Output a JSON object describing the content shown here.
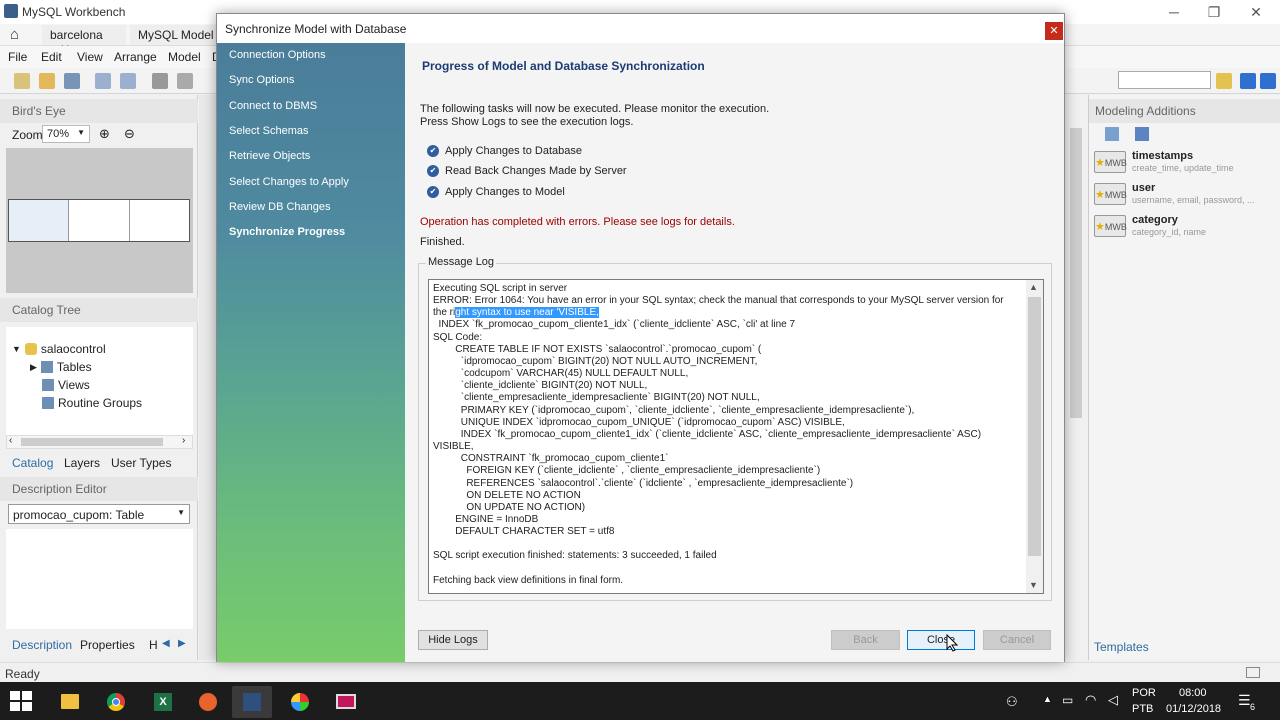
{
  "app": {
    "title": "MySQL Workbench",
    "tabs": [
      "barcelona",
      "MySQL Model (mo"
    ],
    "menu": [
      "File",
      "Edit",
      "View",
      "Arrange",
      "Model",
      "D"
    ],
    "status": "Ready"
  },
  "left": {
    "birds_eye": "Bird's Eye",
    "zoom_label": "Zoom:",
    "zoom_value": "70%",
    "catalog_tree": "Catalog Tree",
    "schema": "salaocontrol",
    "tree_items": [
      "Tables",
      "Views",
      "Routine Groups"
    ],
    "subtabs": [
      "Catalog",
      "Layers",
      "User Types"
    ],
    "description_editor": "Description Editor",
    "desc_select": "promocao_cupom: Table",
    "bottom_tabs": [
      "Description",
      "Properties",
      "H"
    ]
  },
  "right": {
    "header": "Modeling Additions",
    "items": [
      {
        "title": "timestamps",
        "sub": "create_time, update_time"
      },
      {
        "title": "user",
        "sub": "username, email, password, ..."
      },
      {
        "title": "category",
        "sub": "category_id, name"
      }
    ],
    "templates": "Templates"
  },
  "dialog": {
    "title": "Synchronize Model with Database",
    "steps": [
      "Connection Options",
      "Sync Options",
      "Connect to DBMS",
      "Select Schemas",
      "Retrieve Objects",
      "Select Changes to Apply",
      "Review DB Changes",
      "Synchronize Progress"
    ],
    "heading": "Progress of Model and Database Synchronization",
    "intro1": "The following tasks will now be executed. Please monitor the execution.",
    "intro2": "Press Show Logs to see the execution logs.",
    "tasks": [
      "Apply Changes to Database",
      "Read Back Changes Made by Server",
      "Apply Changes to Model"
    ],
    "error": "Operation has completed with errors. Please see logs for details.",
    "finished": "Finished.",
    "log_label": "Message Log",
    "log_line1": "Executing SQL script in server",
    "log_line2": "ERROR: Error 1064: You have an error in your SQL syntax; check the manual that corresponds to your MySQL server version for",
    "log_line3a": "the ri",
    "log_line3b": "ght syntax to use near 'VISIBLE,",
    "log_rest": "  INDEX `fk_promocao_cupom_cliente1_idx` (`cliente_idcliente` ASC, `cli' at line 7\nSQL Code:\n        CREATE TABLE IF NOT EXISTS `salaocontrol`.`promocao_cupom` (\n          `idpromocao_cupom` BIGINT(20) NOT NULL AUTO_INCREMENT,\n          `codcupom` VARCHAR(45) NULL DEFAULT NULL,\n          `cliente_idcliente` BIGINT(20) NOT NULL,\n          `cliente_empresacliente_idempresacliente` BIGINT(20) NOT NULL,\n          PRIMARY KEY (`idpromocao_cupom`, `cliente_idcliente`, `cliente_empresacliente_idempresacliente`),\n          UNIQUE INDEX `idpromocao_cupom_UNIQUE` (`idpromocao_cupom` ASC) VISIBLE,\n          INDEX `fk_promocao_cupom_cliente1_idx` (`cliente_idcliente` ASC, `cliente_empresacliente_idempresacliente` ASC)\nVISIBLE,\n          CONSTRAINT `fk_promocao_cupom_cliente1`\n            FOREIGN KEY (`cliente_idcliente` , `cliente_empresacliente_idempresacliente`)\n            REFERENCES `salaocontrol`.`cliente` (`idcliente` , `empresacliente_idempresacliente`)\n            ON DELETE NO ACTION\n            ON UPDATE NO ACTION)\n        ENGINE = InnoDB\n        DEFAULT CHARACTER SET = utf8\n\nSQL script execution finished: statements: 3 succeeded, 1 failed\n\nFetching back view definitions in final form.",
    "buttons": {
      "hide_logs": "Hide Logs",
      "back": "Back",
      "close": "Close",
      "cancel": "Cancel"
    }
  },
  "taskbar": {
    "lang1": "POR",
    "lang2": "PTB",
    "time": "08:00",
    "date": "01/12/2018",
    "notif": "6"
  }
}
